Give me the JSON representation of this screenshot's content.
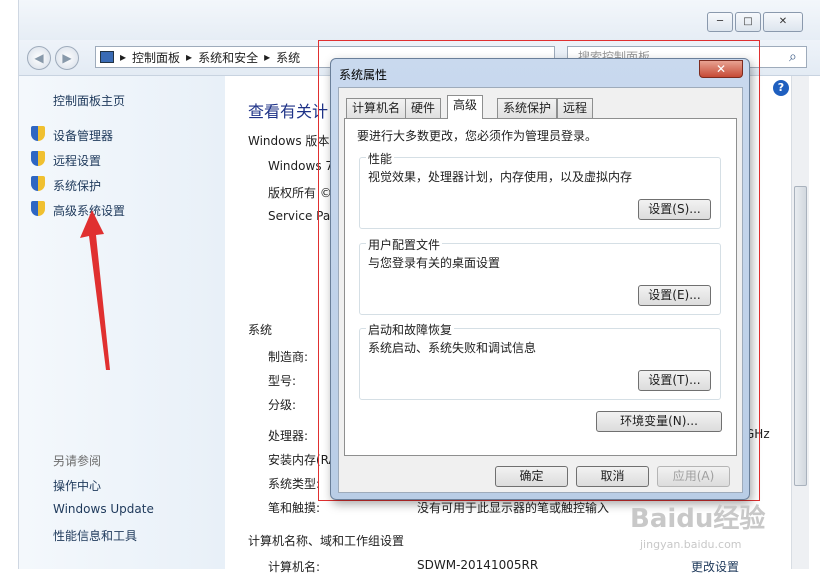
{
  "window": {
    "minimize": "─",
    "maximize": "□",
    "close": "✕"
  },
  "nav": {
    "breadcrumb": [
      "控制面板",
      "系统和安全",
      "系统"
    ],
    "separator": "▸",
    "search_placeholder": "搜索控制面板"
  },
  "sidebar": {
    "home": "控制面板主页",
    "items": [
      {
        "label": "设备管理器"
      },
      {
        "label": "远程设置"
      },
      {
        "label": "系统保护"
      },
      {
        "label": "高级系统设置"
      }
    ],
    "see_also": "另请参阅",
    "links": [
      "操作中心",
      "Windows Update",
      "性能信息和工具"
    ]
  },
  "main": {
    "heading": "查看有关计",
    "edition_section": "Windows 版本",
    "edition": "Windows 7",
    "copyright": "版权所有 ©",
    "service_pack": "Service Pac",
    "system_section": "系统",
    "manufacturer": "制造商:",
    "model": "型号:",
    "rating": "分级:",
    "processor": "处理器:",
    "processor_tail": "GHz",
    "ram": "安装内存(RA",
    "system_type": "系统类型:",
    "pen_touch": "笔和触摸:",
    "pen_touch_value": "没有可用于此显示器的笔或触控输入",
    "computer_section": "计算机名称、域和工作组设置",
    "computer_name_label": "计算机名:",
    "computer_name_value": "SDWM-20141005RR",
    "change_settings": "更改设置"
  },
  "dialog": {
    "title": "系统属性",
    "close": "✕",
    "tabs": [
      "计算机名",
      "硬件",
      "高级",
      "系统保护",
      "远程"
    ],
    "active_tab": "高级",
    "admin_note": "要进行大多数更改，您必须作为管理员登录。",
    "groups": [
      {
        "title": "性能",
        "desc": "视觉效果，处理器计划，内存使用，以及虚拟内存",
        "button": "设置(S)..."
      },
      {
        "title": "用户配置文件",
        "desc": "与您登录有关的桌面设置",
        "button": "设置(E)..."
      },
      {
        "title": "启动和故障恢复",
        "desc": "系统启动、系统失败和调试信息",
        "button": "设置(T)..."
      }
    ],
    "env_button": "环境变量(N)...",
    "ok": "确定",
    "cancel": "取消",
    "apply": "应用(A)"
  },
  "watermark": {
    "logo": "Baidu经验",
    "url": "jingyan.baidu.com"
  },
  "colors": {
    "link": "#1e395b",
    "heading": "#1e3287",
    "annotation_red": "#e03030"
  }
}
